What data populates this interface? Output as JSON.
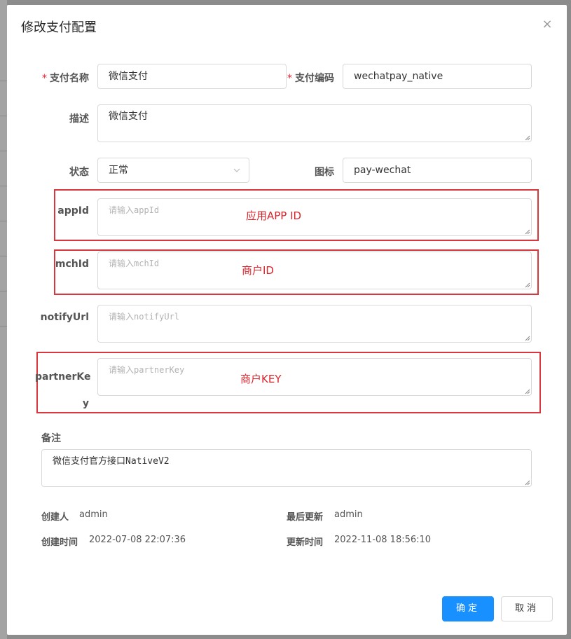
{
  "dialog": {
    "title": "修改支付配置",
    "close_symbol": "×"
  },
  "form": {
    "pay_name": {
      "label": "支付名称",
      "required": "*",
      "value": "微信支付"
    },
    "pay_code": {
      "label": "支付编码",
      "required": "*",
      "value": "wechatpay_native"
    },
    "description": {
      "label": "描述",
      "value": "微信支付"
    },
    "status": {
      "label": "状态",
      "value": "正常"
    },
    "icon": {
      "label": "图标",
      "value": "pay-wechat"
    },
    "app_id": {
      "label": "appId",
      "placeholder": "请输入appId"
    },
    "mch_id": {
      "label": "mchId",
      "placeholder": "请输入mchId"
    },
    "notify_url": {
      "label": "notifyUrl",
      "placeholder": "请输入notifyUrl"
    },
    "partner_key": {
      "label_line1": "partnerKe",
      "label_line2": "y",
      "placeholder": "请输入partnerKey"
    },
    "remark": {
      "label": "备注",
      "value": "微信支付官方接口NativeV2"
    }
  },
  "annotations": {
    "app_id": "应用APP ID",
    "mch_id": "商户ID",
    "partner_key": "商户KEY",
    "color": "#d9242c"
  },
  "meta": {
    "creator_label": "创建人",
    "creator": "admin",
    "updater_label": "最后更新",
    "updater": "admin",
    "created_label": "创建时间",
    "created": "2022-07-08 22:07:36",
    "updated_label": "更新时间",
    "updated": "2022-11-08 18:56:10"
  },
  "footer": {
    "confirm": "确定",
    "cancel": "取消"
  },
  "colors": {
    "primary": "#1890ff",
    "required": "#f5222d"
  }
}
